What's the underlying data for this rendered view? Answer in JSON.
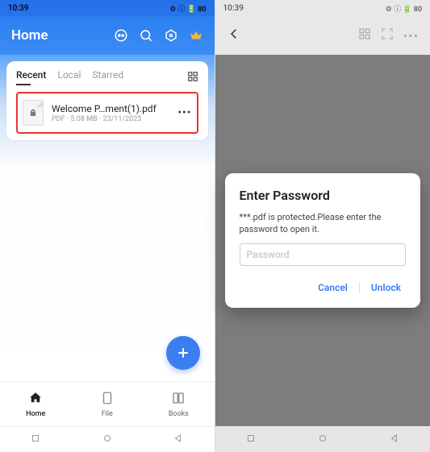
{
  "status": {
    "time": "10:39",
    "indicators": "⚙ ⓘ 🔋 80"
  },
  "left": {
    "header": {
      "title": "Home"
    },
    "tabs": {
      "recent": "Recent",
      "local": "Local",
      "starred": "Starred"
    },
    "file": {
      "name": "Welcome P…ment(1).pdf",
      "meta": "PDF · 5.08 MB · 23/11/2023",
      "more": "•••"
    },
    "nav": {
      "home": "Home",
      "file": "File",
      "books": "Books"
    }
  },
  "right": {
    "dialog": {
      "title": "Enter Password",
      "message": "***.pdf is protected.Please enter the password to open it.",
      "placeholder": "Password",
      "cancel": "Cancel",
      "unlock": "Unlock"
    }
  }
}
